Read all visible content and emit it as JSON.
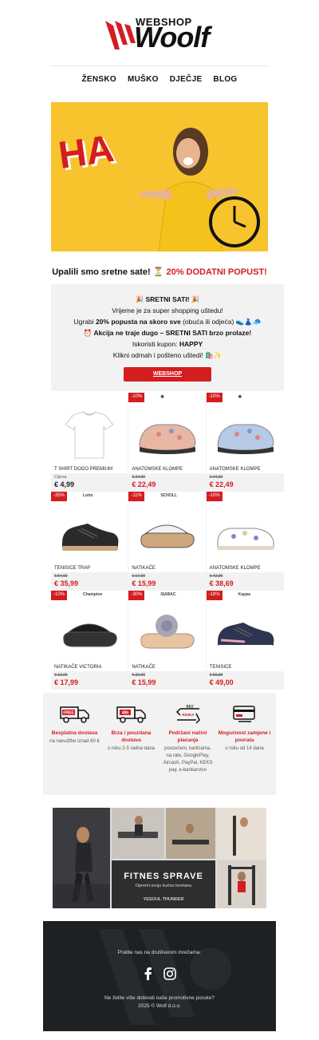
{
  "header": {
    "logo_top": "WEBSHOP",
    "logo_main": "Woolf",
    "nav": [
      "ŽENSKO",
      "MUŠKO",
      "DJEČJE",
      "BLOG"
    ]
  },
  "hero": {
    "text": "HA"
  },
  "tagline": {
    "main": "Upalili smo sretne sate! ⏳ ",
    "highlight": "20% DODATNI POPUST!"
  },
  "promo": {
    "line1": "🎉 SRETNI SATI! 🎉",
    "line2": "Vrijeme je za super shopping uštedu!",
    "line3_pre": "Ugrabi ",
    "line3_bold": "20% popusta na skoro sve",
    "line3_post": " (obuća ili odjeća) 👟👗🧢",
    "line4": "⏰ Akcija ne traje dugo – SRETNI SATI brzo prolaze!",
    "line5_pre": "Iskoristi kupon: ",
    "line5_bold": "HAPPY",
    "line6": "Klikni odmah i pošteno uštedi! 🛍️✨",
    "button": "WEBSHOP"
  },
  "products": [
    {
      "name": "T SHIRT DOGO PREMIUM",
      "sub": "Cijena",
      "price": "€ 4,99",
      "badge": "",
      "brand": "",
      "type": "tshirt",
      "color": "#ffffff"
    },
    {
      "name": "ANATOMSKE KLOMPE",
      "old": "€ 24,99",
      "price": "€ 22,49",
      "badge": "-10%",
      "brand": "◉",
      "type": "clog",
      "color": "#e7b7a4"
    },
    {
      "name": "ANATOMSKE KLOMPE",
      "old": "€ 24,99",
      "price": "€ 22,49",
      "badge": "-10%",
      "brand": "◉",
      "type": "clog",
      "color": "#b7c9e6"
    },
    {
      "name": "TENISICE TRAP",
      "old": "€ 54,99",
      "price": "€ 35,99",
      "badge": "-35%",
      "brand": "Lotto",
      "type": "sneaker",
      "color": "#2a2a2a"
    },
    {
      "name": "NATIKAČE",
      "old": "€ 17,99",
      "price": "€ 15,99",
      "badge": "-11%",
      "brand": "SCHOLL",
      "type": "slide",
      "color": "#cfa57c"
    },
    {
      "name": "ANATOMSKE KLOMPE",
      "old": "€ 42,99",
      "price": "€ 38,69",
      "badge": "-10%",
      "brand": "",
      "type": "sandal",
      "color": "#c3d6a0"
    },
    {
      "name": "NATIKAČE VICTORIA",
      "old": "€ 19,99",
      "price": "€ 17,99",
      "badge": "-10%",
      "brand": "Champion",
      "type": "slide",
      "color": "#333333"
    },
    {
      "name": "NATIKAČE",
      "old": "€ 22,99",
      "price": "€ 15,99",
      "badge": "-30%",
      "brand": "ISABAC",
      "type": "flowerslide",
      "color": "#e8c4a0"
    },
    {
      "name": "TENISICE",
      "old": "€ 59,99",
      "price": "€ 49,00",
      "badge": "-18%",
      "brand": "Kappa",
      "type": "sneaker",
      "color": "#2d3550"
    }
  ],
  "features": [
    {
      "title": "Besplatna dostava",
      "desc": "na narudžbe iznad 60 €",
      "icon": "truck-free-icon",
      "tag": "FREE"
    },
    {
      "title": "Brza i pouzdana dostava",
      "desc": "u roku 2-5 radna dana",
      "icon": "truck-48h-icon",
      "tag": "48h"
    },
    {
      "title": "Podržani načini plaćanja",
      "desc": "pouzećem, karticama, na rate, GooglePlay, Aircash, PayPal, KEKS pay, e-bankarstvo",
      "icon": "no-risk-icon",
      "tag": "BEZ RIZIKA"
    },
    {
      "title": "Mogućnost zamjene i povrata",
      "desc": "u roku od 14 dana",
      "icon": "card-return-icon",
      "tag": ""
    }
  ],
  "fitness": {
    "title": "FITNES SPRAVE",
    "subtitle": "Opremi svoju kućnu teretanu",
    "brands": [
      "YESOUL",
      "THUNDER"
    ]
  },
  "footer": {
    "follow": "Pratite nas na društvenim mrežama:",
    "unsubscribe": "Ne želite više dobivati naše promotivne poruke?",
    "copyright": "2025 © Wolf d.o.o.",
    "socials": [
      "facebook-icon",
      "instagram-icon"
    ]
  },
  "colors": {
    "accent": "#d41d20",
    "hero_bg": "#f7c42e",
    "footer_bg": "#1d2124",
    "panel": "#f2f2f2"
  }
}
